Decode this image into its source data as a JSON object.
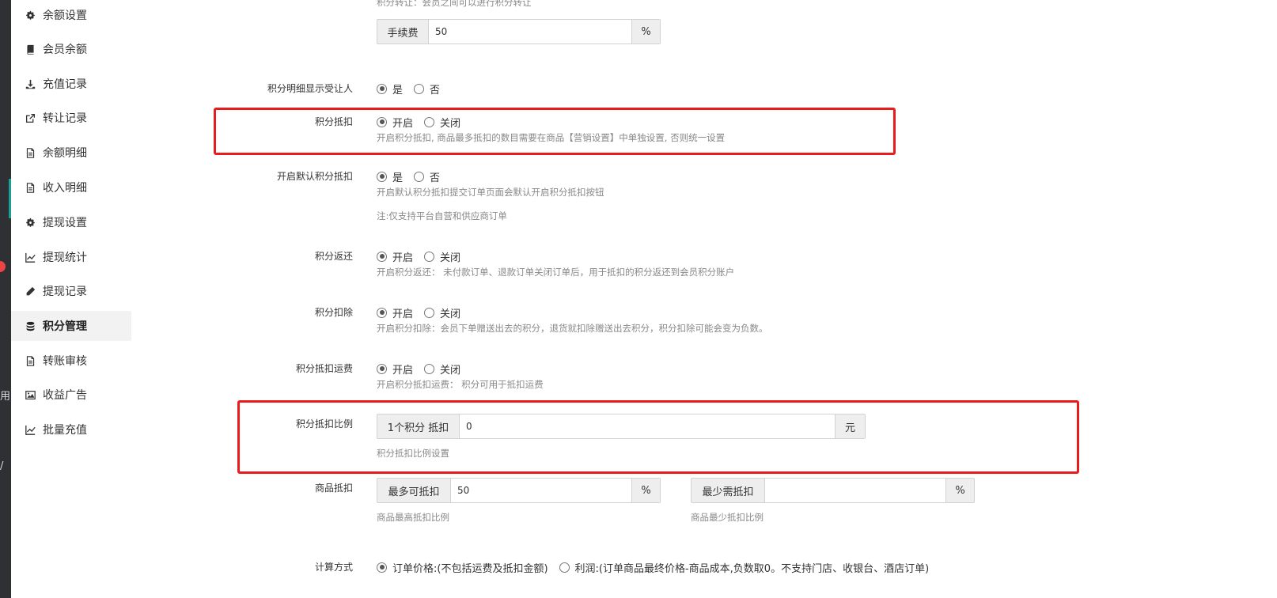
{
  "dark_strip": {
    "glyph_a": "用",
    "glyph_b": "/"
  },
  "sidebar": {
    "items": [
      {
        "label": "余额设置",
        "icon": "gear-icon"
      },
      {
        "label": "会员余额",
        "icon": "book-icon"
      },
      {
        "label": "充值记录",
        "icon": "download-icon"
      },
      {
        "label": "转让记录",
        "icon": "external-link-icon"
      },
      {
        "label": "余额明细",
        "icon": "file-icon"
      },
      {
        "label": "收入明细",
        "icon": "file-icon"
      },
      {
        "label": "提现设置",
        "icon": "gear-icon"
      },
      {
        "label": "提现统计",
        "icon": "line-chart-icon"
      },
      {
        "label": "提现记录",
        "icon": "pencil-icon"
      },
      {
        "label": "积分管理",
        "icon": "database-icon",
        "active": true
      },
      {
        "label": "转账审核",
        "icon": "file-icon"
      },
      {
        "label": "收益广告",
        "icon": "image-icon"
      },
      {
        "label": "批量充值",
        "icon": "line-chart-icon"
      }
    ]
  },
  "form": {
    "transfer_hint": "积分转让：会员之间可以进行积分转让",
    "fee": {
      "addon": "手续费",
      "value": "50",
      "unit": "%"
    },
    "show_recipient": {
      "label": "积分明细显示受让人",
      "opt_yes": "是",
      "opt_no": "否",
      "selected": "yes"
    },
    "deduct": {
      "label": "积分抵扣",
      "opt_on": "开启",
      "opt_off": "关闭",
      "selected": "on",
      "hint": "开启积分抵扣, 商品最多抵扣的数目需要在商品【营销设置】中单独设置, 否则统一设置"
    },
    "default_deduct": {
      "label": "开启默认积分抵扣",
      "opt_yes": "是",
      "opt_no": "否",
      "selected": "yes",
      "hint": "开启默认积分抵扣提交订单页面会默认开启积分抵扣按钮",
      "note": "注:仅支持平台自营和供应商订单"
    },
    "refund": {
      "label": "积分返还",
      "opt_on": "开启",
      "opt_off": "关闭",
      "selected": "on",
      "hint": "开启积分返还：  未付款订单、退款订单关闭订单后，用于抵扣的积分返还到会员积分账户"
    },
    "deduction": {
      "label": "积分扣除",
      "opt_on": "开启",
      "opt_off": "关闭",
      "selected": "on",
      "hint": "开启积分扣除：会员下单赠送出去的积分，退货就扣除赠送出去积分，积分扣除可能会变为负数。"
    },
    "freight": {
      "label": "积分抵扣运费",
      "opt_on": "开启",
      "opt_off": "关闭",
      "selected": "on",
      "hint": "开启积分抵扣运费：  积分可用于抵扣运费"
    },
    "ratio": {
      "label": "积分抵扣比例",
      "addon": "1个积分 抵扣",
      "value": "0",
      "unit": "元",
      "hint": "积分抵扣比例设置"
    },
    "goods": {
      "label": "商品抵扣",
      "max_addon": "最多可抵扣",
      "max_value": "50",
      "max_unit": "%",
      "max_hint": "商品最高抵扣比例",
      "min_addon": "最少需抵扣",
      "min_value": "",
      "min_unit": "%",
      "min_hint": "商品最少抵扣比例"
    },
    "calc": {
      "label": "计算方式",
      "opt_price": "订单价格:(不包括运费及抵扣金额)",
      "opt_profit": "利润:(订单商品最终价格-商品成本,负数取0。不支持门店、收银台、酒店订单)",
      "selected": "price"
    }
  },
  "colors": {
    "highlight_box": "#e81c1c",
    "active_mark": "#1aa094"
  }
}
